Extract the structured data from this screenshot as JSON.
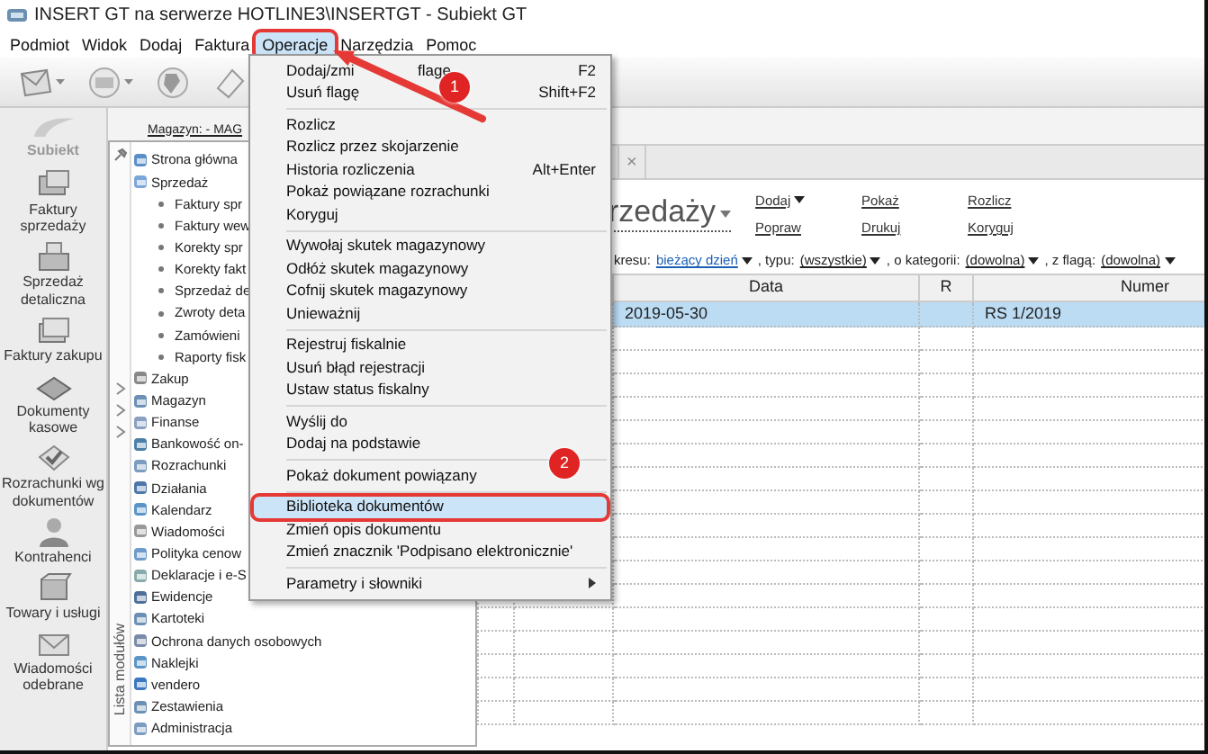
{
  "window": {
    "title": "INSERT GT na serwerze HOTLINE3\\INSERTGT - Subiekt GT"
  },
  "menubar": [
    {
      "label": "Podmiot",
      "selected": false
    },
    {
      "label": "Widok",
      "selected": false
    },
    {
      "label": "Dodaj",
      "selected": false
    },
    {
      "label": "Faktura",
      "selected": false
    },
    {
      "label": "Operacje",
      "selected": true
    },
    {
      "label": "Narzędzia",
      "selected": false
    },
    {
      "label": "Pomoc",
      "selected": false
    }
  ],
  "sidebar": {
    "logo": "Subiekt",
    "items": [
      {
        "label": "Faktury sprzedaży"
      },
      {
        "label": "Sprzedaż detaliczna"
      },
      {
        "label": "Faktury zakupu"
      },
      {
        "label": "Dokumenty kasowe"
      },
      {
        "label": "Rozrachunki wg dokumentów"
      },
      {
        "label": "Kontrahenci"
      },
      {
        "label": "Towary i usługi"
      },
      {
        "label": "Wiadomości odebrane"
      }
    ]
  },
  "module_panel": {
    "label": "Lista modułów",
    "items": [
      {
        "label": "Strona główna"
      },
      {
        "label": "Sprzedaż",
        "children": [
          {
            "label": "Faktury spr"
          },
          {
            "label": "Faktury wew"
          },
          {
            "label": "Korekty spr"
          },
          {
            "label": "Korekty fakt"
          },
          {
            "label": "Sprzedaż de"
          },
          {
            "label": "Zwroty deta"
          },
          {
            "label": "Zamówieni"
          },
          {
            "label": "Raporty fisk"
          }
        ]
      },
      {
        "label": "Zakup"
      },
      {
        "label": "Magazyn"
      },
      {
        "label": "Finanse"
      },
      {
        "label": "Bankowość on-"
      },
      {
        "label": "Rozrachunki"
      },
      {
        "label": "Działania"
      },
      {
        "label": "Kalendarz"
      },
      {
        "label": "Wiadomości"
      },
      {
        "label": "Polityka cenow"
      },
      {
        "label": "Deklaracje i e-S"
      },
      {
        "label": "Ewidencje"
      },
      {
        "label": "Kartoteki"
      },
      {
        "label": "Ochrona danych osobowych"
      },
      {
        "label": "Naklejki"
      },
      {
        "label": "vendero"
      },
      {
        "label": "Zestawienia"
      },
      {
        "label": "Administracja"
      }
    ]
  },
  "workspace": {
    "store_link": "Magazyn: - MAG",
    "tab_close": "×",
    "title": "rzedaży",
    "actions": [
      [
        {
          "label": "Dodaj",
          "dropdown": true
        },
        {
          "label": "Popraw",
          "dropdown": false
        }
      ],
      [
        {
          "label": "Pokaż",
          "dropdown": false
        },
        {
          "label": "Drukuj",
          "dropdown": false
        }
      ],
      [
        {
          "label": "Rozlicz",
          "dropdown": false
        },
        {
          "label": "Koryguj",
          "dropdown": false
        }
      ]
    ],
    "filters": [
      {
        "kind": "label",
        "text": "kresu:"
      },
      {
        "kind": "link",
        "text": "bieżący dzień"
      },
      {
        "kind": "label",
        "text": ", typu:"
      },
      {
        "kind": "link",
        "text": "(wszystkie)"
      },
      {
        "kind": "label",
        "text": ", o kategorii:"
      },
      {
        "kind": "link",
        "text": "(dowolna)"
      },
      {
        "kind": "label",
        "text": ", z flagą:"
      },
      {
        "kind": "link",
        "text": "(dowolna)"
      }
    ],
    "table": {
      "columns": [
        {
          "kind": "date",
          "label": "Data"
        },
        {
          "kind": "flag",
          "label": "R"
        },
        {
          "kind": "number",
          "label": "Numer"
        }
      ],
      "rows": [
        {
          "date": "2019-05-30",
          "number": "RS 1/2019",
          "selected": true
        }
      ]
    }
  },
  "menu": {
    "groups": [
      [
        {
          "label": "Dodaj/zmi",
          "label_after": "flagę",
          "shortcut": "F2",
          "selected": false,
          "submenu": false
        },
        {
          "label": "Usuń flagę",
          "shortcut": "Shift+F2",
          "selected": false,
          "submenu": false
        }
      ],
      [
        {
          "label": "Rozlicz",
          "selected": false,
          "submenu": false
        },
        {
          "label": "Rozlicz przez skojarzenie",
          "selected": false,
          "submenu": false
        },
        {
          "label": "Historia rozliczenia",
          "shortcut": "Alt+Enter",
          "selected": false,
          "submenu": false
        },
        {
          "label": "Pokaż powiązane rozrachunki",
          "selected": false,
          "submenu": false
        },
        {
          "label": "Koryguj",
          "selected": false,
          "submenu": false
        }
      ],
      [
        {
          "label": "Wywołaj skutek magazynowy",
          "selected": false,
          "submenu": false
        },
        {
          "label": "Odłóż skutek magazynowy",
          "selected": false,
          "submenu": false
        },
        {
          "label": "Cofnij skutek magazynowy",
          "selected": false,
          "submenu": false
        },
        {
          "label": "Unieważnij",
          "selected": false,
          "submenu": false
        }
      ],
      [
        {
          "label": "Rejestruj fiskalnie",
          "selected": false,
          "submenu": false
        },
        {
          "label": "Usuń błąd rejestracji",
          "selected": false,
          "submenu": false
        },
        {
          "label": "Ustaw status fiskalny",
          "selected": false,
          "submenu": false
        }
      ],
      [
        {
          "label": "Wyślij do",
          "selected": false,
          "submenu": false
        },
        {
          "label": "Dodaj na podstawie",
          "selected": false,
          "submenu": false
        }
      ],
      [
        {
          "label": "Pokaż dokument powiązany",
          "selected": false,
          "submenu": false
        }
      ],
      [
        {
          "label": "Biblioteka dokumentów",
          "selected": true,
          "submenu": false
        },
        {
          "label": "Zmień opis dokumentu",
          "selected": false,
          "submenu": false
        },
        {
          "label": "Zmień znacznik 'Podpisano elektronicznie'",
          "selected": false,
          "submenu": false
        }
      ],
      [
        {
          "label": "Parametry i słowniki",
          "selected": false,
          "submenu": true
        }
      ]
    ]
  },
  "annotations": [
    {
      "label": "1"
    },
    {
      "label": "2"
    }
  ]
}
